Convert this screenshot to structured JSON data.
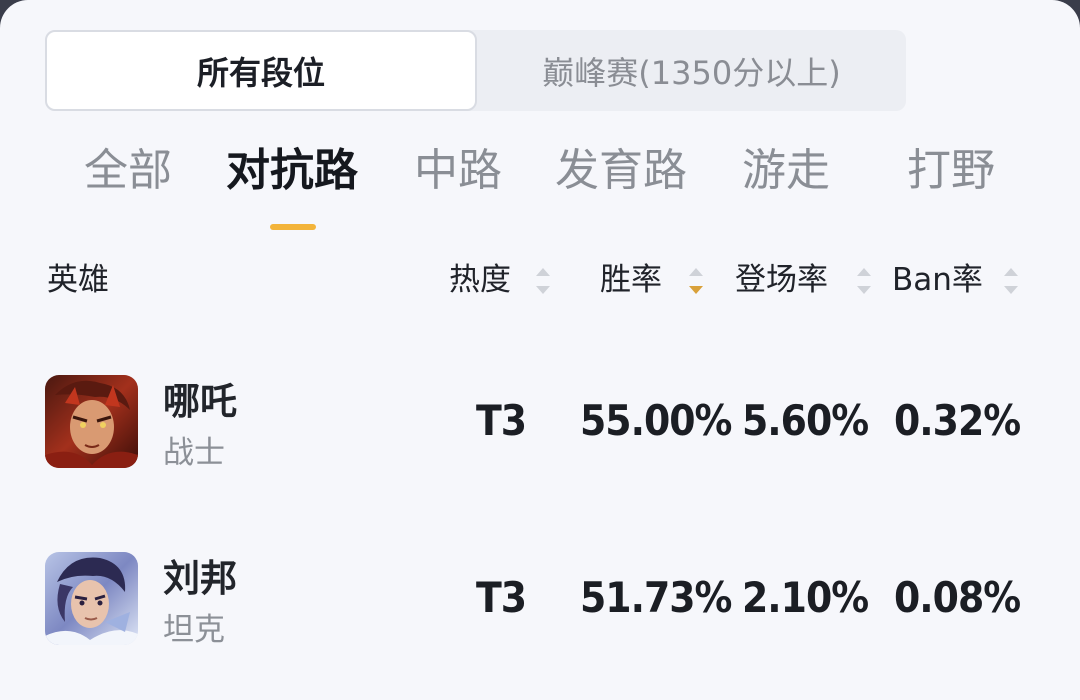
{
  "rank_switch": {
    "all_ranks": "所有段位",
    "peak": "巅峰赛(1350分以上)"
  },
  "lanes": [
    "全部",
    "对抗路",
    "中路",
    "发育路",
    "游走",
    "打野"
  ],
  "active_lane": "对抗路",
  "accent_color": "#f3b43a",
  "columns": {
    "hero": "英雄",
    "heat": "热度",
    "win_rate": "胜率",
    "pick_rate": "登场率",
    "ban_rate": "Ban率"
  },
  "sort_active_column": "win_rate",
  "sort_direction": "descending",
  "heroes": [
    {
      "name": "哪吒",
      "role": "战士",
      "avatar_icon": "nezha-avatar",
      "heat": "T3",
      "win_rate": "55.00%",
      "pick_rate": "5.60%",
      "ban_rate": "0.32%"
    },
    {
      "name": "刘邦",
      "role": "坦克",
      "avatar_icon": "liubang-avatar",
      "heat": "T3",
      "win_rate": "51.73%",
      "pick_rate": "2.10%",
      "ban_rate": "0.08%"
    }
  ]
}
